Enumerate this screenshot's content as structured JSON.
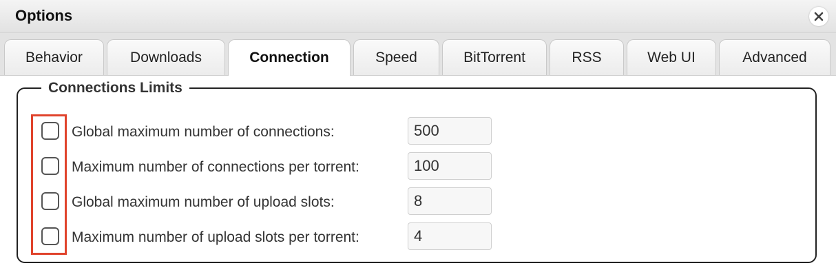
{
  "window": {
    "title": "Options",
    "close_icon": "close-icon"
  },
  "tabs": [
    {
      "label": "Behavior",
      "active": false
    },
    {
      "label": "Downloads",
      "active": false
    },
    {
      "label": "Connection",
      "active": true
    },
    {
      "label": "Speed",
      "active": false
    },
    {
      "label": "BitTorrent",
      "active": false
    },
    {
      "label": "RSS",
      "active": false
    },
    {
      "label": "Web UI",
      "active": false
    },
    {
      "label": "Advanced",
      "active": false
    }
  ],
  "connections_limits": {
    "legend": "Connections Limits",
    "rows": [
      {
        "label": "Global maximum number of connections:",
        "value": "500",
        "checked": false
      },
      {
        "label": "Maximum number of connections per torrent:",
        "value": "100",
        "checked": false
      },
      {
        "label": "Global maximum number of upload slots:",
        "value": "8",
        "checked": false
      },
      {
        "label": "Maximum number of upload slots per torrent:",
        "value": "4",
        "checked": false
      }
    ]
  },
  "colors": {
    "highlight": "#e0432c",
    "titlebar": "#e8e8e8",
    "tabstrip": "#e3e3e3"
  }
}
